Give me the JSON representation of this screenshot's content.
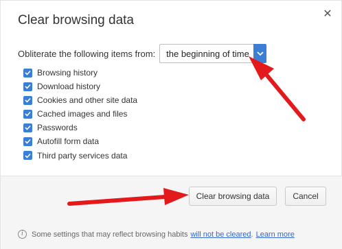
{
  "dialog": {
    "title": "Clear browsing data",
    "close_glyph": "✕"
  },
  "period": {
    "label": "Obliterate the following items from:",
    "value": "the beginning of time"
  },
  "items": [
    {
      "label": "Browsing history",
      "checked": true
    },
    {
      "label": "Download history",
      "checked": true
    },
    {
      "label": "Cookies and other site data",
      "checked": true
    },
    {
      "label": "Cached images and files",
      "checked": true
    },
    {
      "label": "Passwords",
      "checked": true
    },
    {
      "label": "Autofill form data",
      "checked": true
    },
    {
      "label": "Third party services data",
      "checked": true
    }
  ],
  "buttons": {
    "clear": "Clear browsing data",
    "cancel": "Cancel"
  },
  "note": {
    "icon": "i",
    "text": "Some settings that may reflect browsing habits",
    "link1": "will not be cleared",
    "period": ".",
    "link2": "Learn more"
  },
  "colors": {
    "accent": "#3a7fd5",
    "annotation_arrow": "#e3191b",
    "link": "#3366cc"
  },
  "icons": [
    "close-icon",
    "chevron-down-icon",
    "checkmark-icon",
    "info-icon",
    "arrow-annotation"
  ]
}
